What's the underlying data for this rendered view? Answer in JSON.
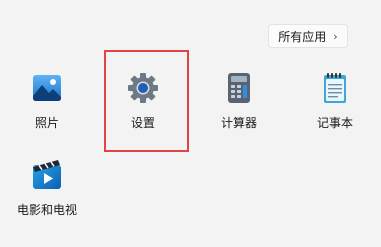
{
  "header": {
    "all_apps_label": "所有应用",
    "all_apps_chevron": "›"
  },
  "apps": [
    {
      "label": "照片",
      "icon": "photos-icon"
    },
    {
      "label": "设置",
      "icon": "settings-gear-icon"
    },
    {
      "label": "计算器",
      "icon": "calculator-icon"
    },
    {
      "label": "记事本",
      "icon": "notepad-icon"
    },
    {
      "label": "电影和电视",
      "icon": "movies-tv-icon"
    }
  ],
  "highlight": {
    "target": "设置",
    "color": "#e04444"
  }
}
